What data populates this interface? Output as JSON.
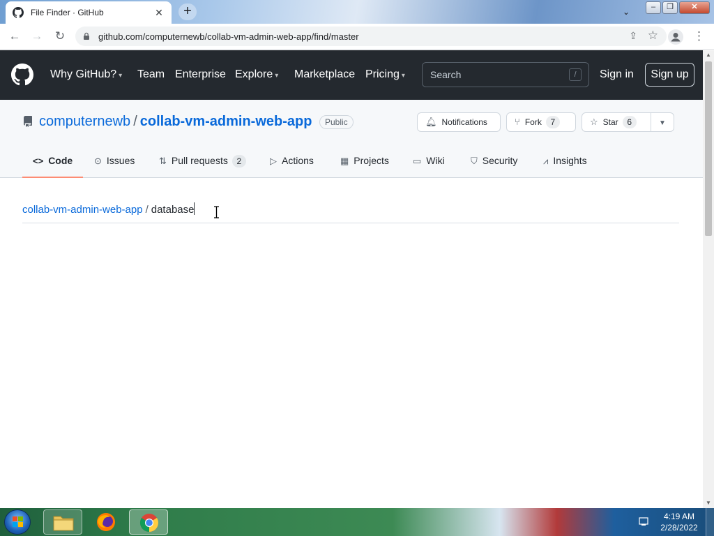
{
  "browser": {
    "tab_title": "File Finder · GitHub",
    "url": "github.com/computernewb/collab-vm-admin-web-app/find/master"
  },
  "gh_header": {
    "nav": [
      "Why GitHub?",
      "Team",
      "Enterprise",
      "Explore",
      "Marketplace",
      "Pricing"
    ],
    "search_placeholder": "Search",
    "search_hotkey": "/",
    "sign_in": "Sign in",
    "sign_up": "Sign up"
  },
  "repo": {
    "owner": "computernewb",
    "separator": "/",
    "name": "collab-vm-admin-web-app",
    "visibility": "Public",
    "notifications_label": "Notifications",
    "fork_label": "Fork",
    "fork_count": "7",
    "star_label": "Star",
    "star_count": "6",
    "tabs": [
      {
        "label": "Code",
        "icon": "code-icon"
      },
      {
        "label": "Issues",
        "icon": "issue-icon"
      },
      {
        "label": "Pull requests",
        "icon": "pull-request-icon",
        "count": "2"
      },
      {
        "label": "Actions",
        "icon": "play-icon"
      },
      {
        "label": "Projects",
        "icon": "table-icon"
      },
      {
        "label": "Wiki",
        "icon": "book-icon"
      },
      {
        "label": "Security",
        "icon": "shield-icon"
      },
      {
        "label": "Insights",
        "icon": "graph-icon"
      }
    ]
  },
  "finder": {
    "repo_crumb": "collab-vm-admin-web-app",
    "separator": "/",
    "query": "database"
  },
  "taskbar": {
    "time": "4:19 AM",
    "date": "2/28/2022"
  },
  "colors": {
    "header_bg": "#24292f",
    "link": "#0969da",
    "selected_tab_underline": "#fd8c73"
  }
}
